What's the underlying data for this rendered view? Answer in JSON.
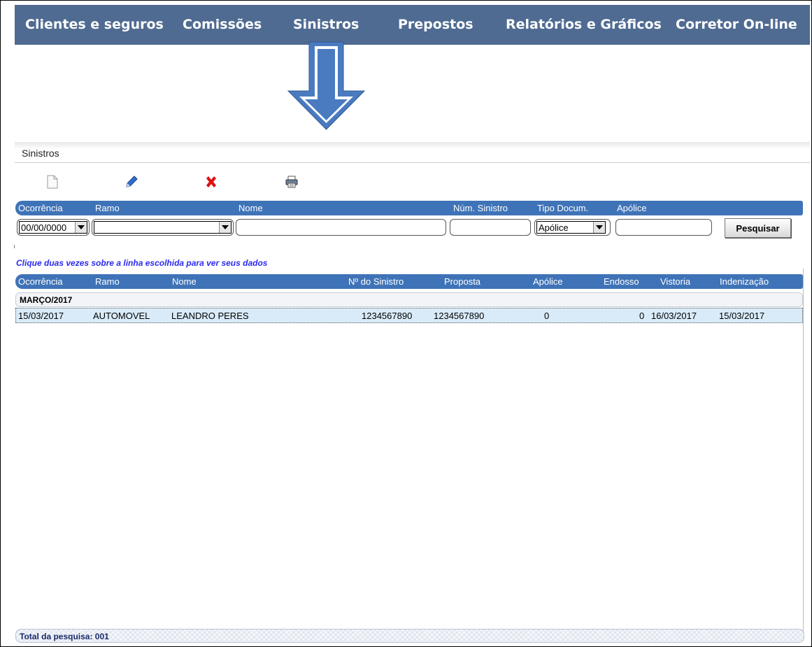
{
  "topnav": {
    "items": [
      {
        "label": "Clientes e seguros"
      },
      {
        "label": "Comissões"
      },
      {
        "label": "Sinistros"
      },
      {
        "label": "Prepostos"
      },
      {
        "label": "Relatórios e Gráficos"
      },
      {
        "label": "Corretor On-line"
      }
    ],
    "background": "#4f6b92"
  },
  "window": {
    "title": "Sinistros"
  },
  "toolbar": {
    "icons": [
      "new-document-icon",
      "edit-pencil-icon",
      "delete-x-icon",
      "print-icon"
    ]
  },
  "search": {
    "headers": [
      "Ocorrência",
      "Ramo",
      "Nome",
      "Núm. Sinistro",
      "Tipo Docum.",
      "Apólice"
    ],
    "ocorrencia_value": "00/00/0000",
    "ramo_value": "",
    "nome_value": "",
    "num_sinistro_value": "",
    "tipo_docum_value": "Apólice",
    "apolice_value": "",
    "button_label": "Pesquisar"
  },
  "hint": "Clique duas vezes sobre a linha escolhida para ver seus dados",
  "results": {
    "headers": [
      "Ocorrência",
      "Ramo",
      "Nome",
      "Nº do Sinistro",
      "Proposta",
      "Apólice",
      "Endosso",
      "Vistoria",
      "Indenização"
    ],
    "group": "MARÇO/2017",
    "rows": [
      {
        "ocorrencia": "15/03/2017",
        "ramo": "AUTOMOVEL",
        "nome": "LEANDRO PERES",
        "num_sinistro": "1234567890",
        "proposta": "1234567890",
        "apolice": "0",
        "endosso": "0",
        "vistoria": "16/03/2017",
        "indenizacao": "15/03/2017"
      }
    ]
  },
  "footer": {
    "total": "Total da pesquisa: 001"
  },
  "colors": {
    "accent_blue": "#3f73b7",
    "hint_blue": "#2a2aef",
    "arrow_blue": "#4a7bc0",
    "delete_red": "#e01010"
  }
}
